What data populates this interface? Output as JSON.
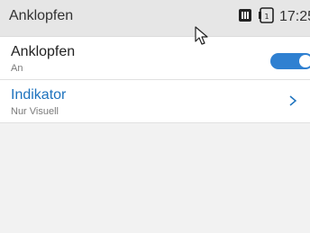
{
  "header": {
    "title": "Anklopfen",
    "time": "17:25",
    "icons": [
      "sim-card-icon",
      "sim-slot-1-icon"
    ]
  },
  "items": [
    {
      "title": "Anklopfen",
      "subtitle": "An",
      "control": "toggle",
      "toggle_on": true
    },
    {
      "title": "Indikator",
      "subtitle": "Nur Visuell",
      "control": "chevron",
      "selected": true
    }
  ],
  "colors": {
    "accent": "#2f80d1",
    "selected_text": "#1e73be",
    "header_bg": "#e6e6e6",
    "item_bg": "#ffffff",
    "screen_bg": "#f2f2f2"
  }
}
